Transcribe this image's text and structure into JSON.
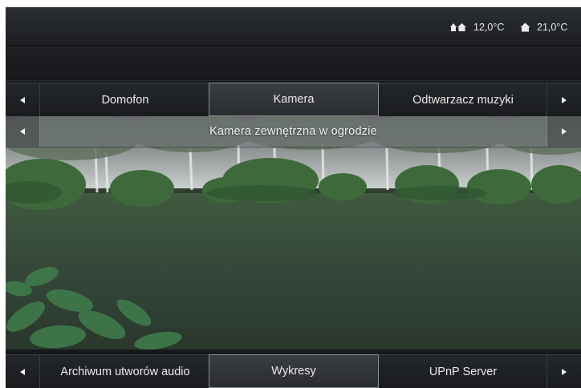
{
  "status": {
    "outdoor_icon": "outdoor-house-tree-icon",
    "outdoor_temp": "12,0°C",
    "indoor_icon": "house-icon",
    "indoor_temp": "21,0°C"
  },
  "top_tabs": {
    "items": [
      {
        "label": "Domofon",
        "active": false
      },
      {
        "label": "Kamera",
        "active": true
      },
      {
        "label": "Odtwarzacz muzyki",
        "active": false
      }
    ]
  },
  "camera": {
    "title": "Kamera zewnętrzna w ogrodzie"
  },
  "bottom_tabs": {
    "items": [
      {
        "label": "Archiwum utworów audio",
        "active": false
      },
      {
        "label": "Wykresy",
        "active": true
      },
      {
        "label": "UPnP Server",
        "active": false
      }
    ]
  },
  "colors": {
    "background": "#16181b",
    "text": "#eaeaea",
    "active_tab_border": "#8a8d91"
  }
}
